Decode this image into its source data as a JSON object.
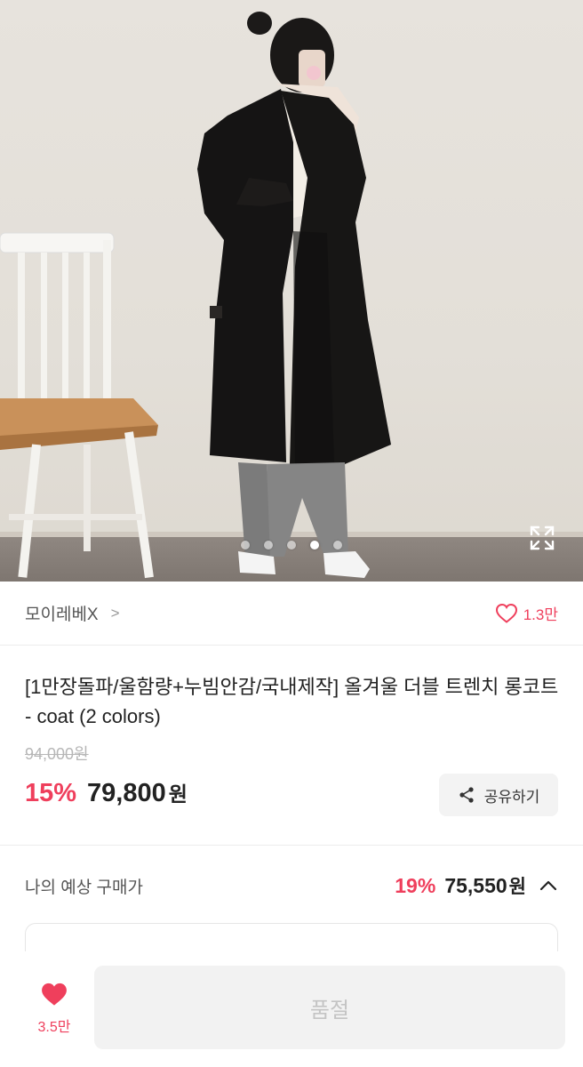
{
  "seller": {
    "name": "모이레베X",
    "chevron": ">",
    "like_count": "1.3만"
  },
  "product": {
    "title": "[1만장돌파/울함량+누빔안감/국내제작] 올겨울 더블 트렌치 롱코트 - coat (2 colors)",
    "original_price": "94,000원",
    "discount": "15%",
    "price": "79,800",
    "currency": "원"
  },
  "share": {
    "label": "공유하기"
  },
  "estimate": {
    "label": "나의 예상 구매가",
    "discount": "19%",
    "price": "75,550",
    "currency": "원",
    "expanded": true
  },
  "carousel": {
    "total": 5,
    "active_index": 3
  },
  "bottom": {
    "wish_count": "3.5만",
    "buy_label": "품절"
  },
  "colors": {
    "accent": "#ef3f5c",
    "text": "#222222",
    "muted": "#b6b6b6",
    "disabled_bg": "#f2f2f2"
  },
  "icons": [
    "expand-icon",
    "chevron-right-icon",
    "heart-outline-icon",
    "share-icon",
    "chevron-up-icon",
    "heart-filled-icon"
  ]
}
